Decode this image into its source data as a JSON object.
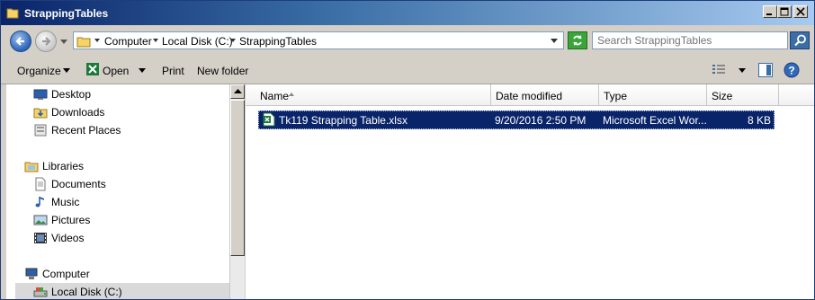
{
  "window": {
    "title": "StrappingTables"
  },
  "address": {
    "crumbs": [
      "Computer",
      "Local Disk (C:)",
      "StrappingTables"
    ]
  },
  "search": {
    "placeholder": "Search StrappingTables"
  },
  "toolbar": {
    "organize_label": "Organize",
    "open_label": "Open",
    "print_label": "Print",
    "new_folder_label": "New folder"
  },
  "nav": {
    "favorites": [
      {
        "label": "Desktop",
        "icon": "desktop-icon"
      },
      {
        "label": "Downloads",
        "icon": "downloads-icon"
      },
      {
        "label": "Recent Places",
        "icon": "recent-places-icon"
      }
    ],
    "libraries_label": "Libraries",
    "libraries": [
      {
        "label": "Documents",
        "icon": "documents-icon"
      },
      {
        "label": "Music",
        "icon": "music-icon"
      },
      {
        "label": "Pictures",
        "icon": "pictures-icon"
      },
      {
        "label": "Videos",
        "icon": "videos-icon"
      }
    ],
    "computer_label": "Computer",
    "computer_items": [
      {
        "label": "Local Disk (C:)",
        "icon": "drive-icon",
        "selected": true
      }
    ]
  },
  "columns": {
    "name": "Name",
    "date_modified": "Date modified",
    "type": "Type",
    "size": "Size"
  },
  "files": [
    {
      "name": "Tk119 Strapping Table.xlsx",
      "date_modified": "9/20/2016 2:50 PM",
      "type": "Microsoft Excel Wor...",
      "size": "8 KB",
      "selected": true
    }
  ],
  "colors": {
    "selection": "#0a246a",
    "titlebar_start": "#0a246a",
    "titlebar_end": "#a6caf0",
    "excel_green": "#1d7a3a"
  }
}
